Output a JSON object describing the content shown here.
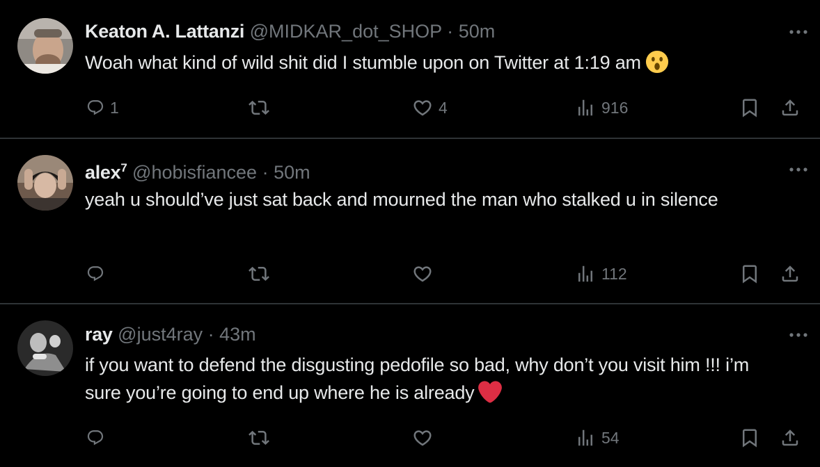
{
  "tweets": [
    {
      "name": "Keaton A. Lattanzi",
      "name_sup": "",
      "handle": "@MIDKAR_dot_SHOP",
      "separator": "·",
      "time": "50m",
      "text": "Woah what kind of wild shit did I stumble upon on Twitter at 1:19 am",
      "emoji": "astonished-face",
      "replies": "1",
      "retweets": "",
      "likes": "4",
      "views": "916"
    },
    {
      "name": "alex",
      "name_sup": "7",
      "handle": "@hobisfiancee",
      "separator": "·",
      "time": "50m",
      "text": "yeah u should’ve just sat back and mourned the man who stalked u in silence",
      "emoji": "",
      "replies": "",
      "retweets": "",
      "likes": "",
      "views": "112"
    },
    {
      "name": "ray",
      "name_sup": "",
      "handle": "@just4ray",
      "separator": "·",
      "time": "43m",
      "text": "if you want to defend the disgusting pedofile so bad, why don’t you visit him !!! i’m sure you’re going to end up where he is already",
      "emoji": "red-heart",
      "replies": "",
      "retweets": "",
      "likes": "",
      "views": "54"
    }
  ],
  "colors": {
    "background": "#000000",
    "text": "#e7e9ea",
    "secondary": "#71767b",
    "divider": "#2f3336",
    "heart": "#f91880"
  }
}
